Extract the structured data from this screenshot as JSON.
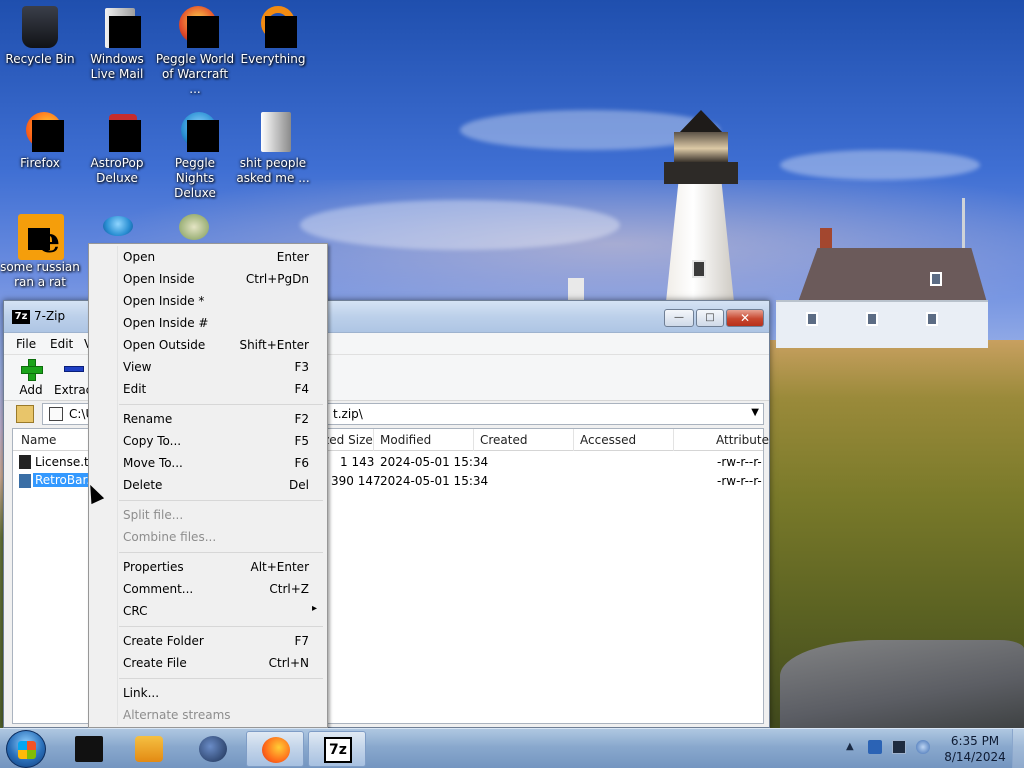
{
  "desktop": {
    "icons": [
      {
        "label": "Recycle Bin"
      },
      {
        "label": "Windows Live Mail"
      },
      {
        "label": "Peggle World of Warcraft ..."
      },
      {
        "label": "Everything"
      },
      {
        "label": "Firefox"
      },
      {
        "label": "AstroPop Deluxe"
      },
      {
        "label": "Peggle Nights Deluxe"
      },
      {
        "label": "shit people asked me ..."
      },
      {
        "label": "some russian ran a rat"
      }
    ]
  },
  "window": {
    "title": "7-Zip",
    "logo": "7z",
    "buttons": {
      "minimize": "—",
      "maximize": "□",
      "close": "✕"
    },
    "menu": [
      "File",
      "Edit",
      "V"
    ],
    "toolbar": {
      "add": "Add",
      "extract": "Extract"
    },
    "address": {
      "path_left": "C:\\U",
      "path_right": "t.zip\\",
      "dropdown": "▼"
    },
    "columns": [
      "Name",
      "zed Size",
      "Modified",
      "Created",
      "Accessed",
      "Attribute"
    ],
    "files": [
      {
        "name": "License.txt",
        "packed": "1 143",
        "modified": "2024-05-01 15:34",
        "attributes": "-rw-r--r-"
      },
      {
        "name": "RetroBar.e",
        "packed": "390 147",
        "modified": "2024-05-01 15:34",
        "attributes": "-rw-r--r-"
      }
    ]
  },
  "context_menu": {
    "groups": [
      [
        {
          "label": "Open",
          "key": "Enter"
        },
        {
          "label": "Open Inside",
          "key": "Ctrl+PgDn"
        },
        {
          "label": "Open Inside *",
          "key": ""
        },
        {
          "label": "Open Inside #",
          "key": ""
        },
        {
          "label": "Open Outside",
          "key": "Shift+Enter"
        },
        {
          "label": "View",
          "key": "F3"
        },
        {
          "label": "Edit",
          "key": "F4"
        }
      ],
      [
        {
          "label": "Rename",
          "key": "F2"
        },
        {
          "label": "Copy To...",
          "key": "F5"
        },
        {
          "label": "Move To...",
          "key": "F6"
        },
        {
          "label": "Delete",
          "key": "Del"
        }
      ],
      [
        {
          "label": "Split file...",
          "key": "",
          "disabled": true
        },
        {
          "label": "Combine files...",
          "key": "",
          "disabled": true
        }
      ],
      [
        {
          "label": "Properties",
          "key": "Alt+Enter"
        },
        {
          "label": "Comment...",
          "key": "Ctrl+Z"
        },
        {
          "label": "CRC",
          "key": "",
          "submenu": true
        }
      ],
      [
        {
          "label": "Create Folder",
          "key": "F7"
        },
        {
          "label": "Create File",
          "key": "Ctrl+N"
        }
      ],
      [
        {
          "label": "Link...",
          "key": ""
        },
        {
          "label": "Alternate streams",
          "key": "",
          "disabled": true
        }
      ]
    ],
    "submenu_arrow": "▸"
  },
  "taskbar": {
    "apps": [
      "generic-app-icon",
      "media-player-icon",
      "globe-icon",
      "firefox-icon",
      "7zip-icon"
    ],
    "seven_zip_label": "7z",
    "clock_time": "6:35 PM",
    "clock_date": "8/14/2024",
    "tray_arrow": "▲"
  },
  "colors": {
    "selection": "#3399ff",
    "accent_green": "#1aa31a",
    "accent_blue": "#1e3fc4"
  }
}
